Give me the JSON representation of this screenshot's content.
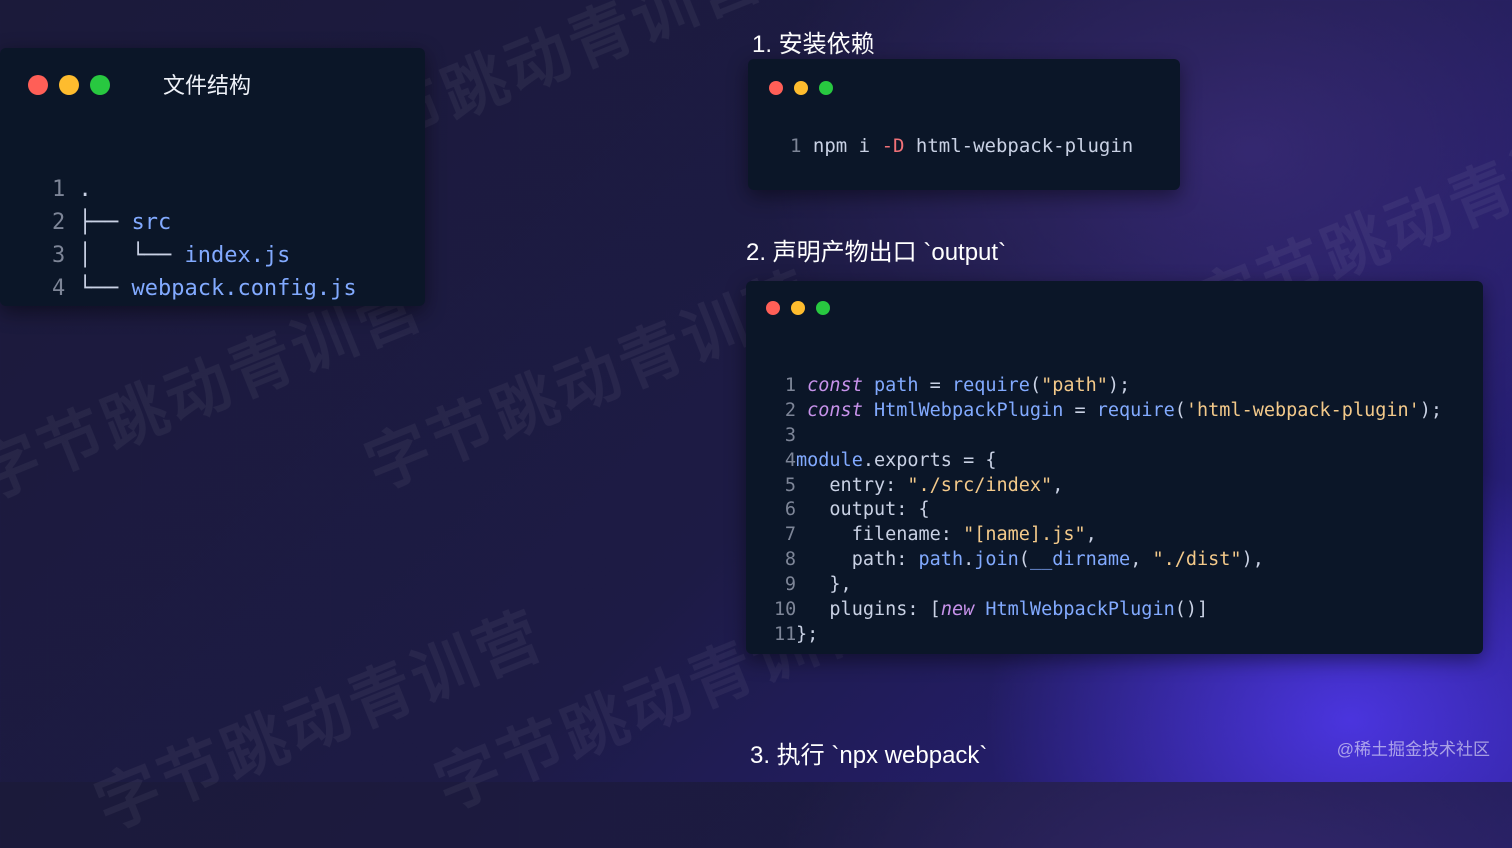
{
  "watermark_text": "字节跳动青训营",
  "file_structure": {
    "title": "文件结构",
    "lines": [
      {
        "num": "1",
        "prefix": "",
        "text": "."
      },
      {
        "num": "2",
        "prefix": "├── ",
        "text": "src"
      },
      {
        "num": "3",
        "prefix": "│   └── ",
        "text": "index.js"
      },
      {
        "num": "4",
        "prefix": "└── ",
        "text": "webpack.config.js"
      }
    ]
  },
  "step1": {
    "heading": "1. 安装依赖",
    "line_num": "1",
    "cmd": "npm i",
    "flag": "-D",
    "pkg": "html-webpack-plugin"
  },
  "step2": {
    "heading": "2. 声明产物出口 `output`",
    "code": {
      "l1": {
        "num": "1",
        "kw": "const",
        "var": "path",
        "eq": " = ",
        "fn": "require",
        "open": "(",
        "str": "\"path\"",
        "close": ");"
      },
      "l2": {
        "num": "2",
        "kw": "const",
        "var": "HtmlWebpackPlugin",
        "eq": " = ",
        "fn": "require",
        "open": "(",
        "str": "'html-webpack-plugin'",
        "close": ");"
      },
      "l3": {
        "num": "3"
      },
      "l4": {
        "num": "4",
        "obj": "module",
        "dot": ".",
        "prop": "exports",
        "rest": " = {"
      },
      "l5": {
        "num": "5",
        "key": "  entry",
        "colon": ": ",
        "str": "\"./src/index\"",
        "end": ","
      },
      "l6": {
        "num": "6",
        "key": "  output",
        "rest": ": {"
      },
      "l7": {
        "num": "7",
        "key": "    filename",
        "colon": ": ",
        "str": "\"[name].js\"",
        "end": ","
      },
      "l8": {
        "num": "8",
        "key": "    path",
        "colon": ": ",
        "obj": "path",
        "dot": ".",
        "fn": "join",
        "open": "(",
        "arg": "__dirname",
        "sep": ", ",
        "str": "\"./dist\"",
        "close": "),"
      },
      "l9": {
        "num": "9",
        "text": "  },"
      },
      "l10": {
        "num": "10",
        "key": "  plugins",
        "colon": ": [",
        "kw": "new",
        "cls": "HtmlWebpackPlugin",
        "close": "()]"
      },
      "l11": {
        "num": "11",
        "text": "};"
      }
    }
  },
  "step3": {
    "heading": "3. 执行 `npx webpack`"
  },
  "credit": "@稀土掘金技术社区"
}
